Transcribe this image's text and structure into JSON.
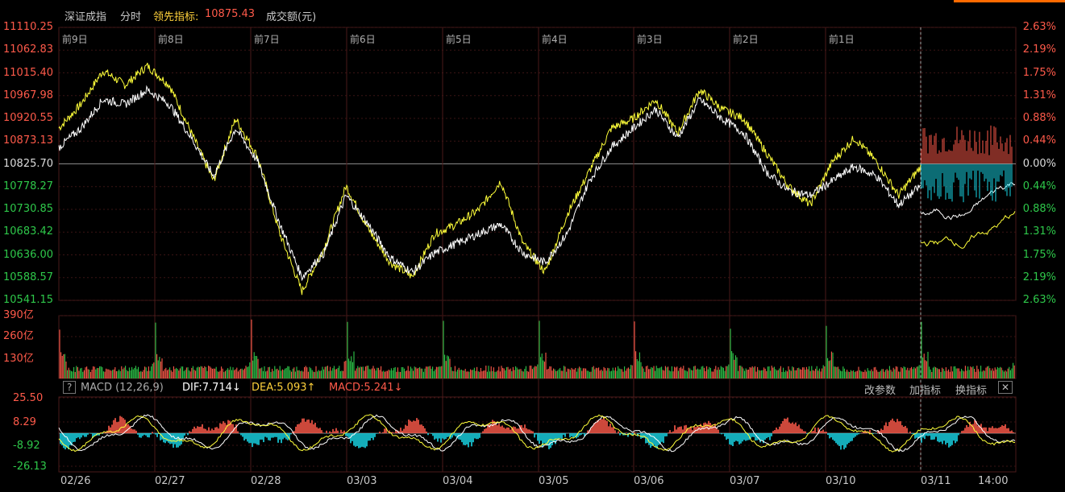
{
  "header": {
    "index_name": "深证成指",
    "mode": "分时",
    "lead_label": "领先指标:",
    "lead_value": "10875.43",
    "volume_label": "成交额(元)"
  },
  "day_labels": [
    "前9日",
    "前8日",
    "前7日",
    "前6日",
    "前5日",
    "前4日",
    "前3日",
    "前2日",
    "前1日"
  ],
  "price_axis": [
    "11110.25",
    "11062.83",
    "11015.40",
    "10967.98",
    "10920.55",
    "10873.13",
    "10825.70",
    "10778.27",
    "10730.85",
    "10683.42",
    "10636.00",
    "10588.57",
    "10541.15"
  ],
  "pct_axis": [
    "2.63%",
    "2.19%",
    "1.75%",
    "1.31%",
    "0.88%",
    "0.44%",
    "0.00%",
    "0.44%",
    "0.88%",
    "1.31%",
    "1.75%",
    "2.19%",
    "2.63%"
  ],
  "volume_axis": [
    "390亿",
    "260亿",
    "130亿"
  ],
  "macd": {
    "help": "?",
    "title": "MACD (12,26,9)",
    "dif": "DIF:7.714↓",
    "dea": "DEA:5.093↑",
    "macd": "MACD:5.241↓",
    "btn_change_params": "改参数",
    "btn_add_indicator": "加指标",
    "btn_switch_indicator": "换指标",
    "btn_close": "✕",
    "axis": [
      "25.50",
      "8.29",
      "-8.92",
      "-26.13"
    ]
  },
  "dates": [
    "02/26",
    "02/27",
    "02/28",
    "03/03",
    "03/04",
    "03/05",
    "03/06",
    "03/07",
    "03/10",
    "03/11",
    "14:00"
  ],
  "colors": {
    "up": "#ff5a4a",
    "down": "#2ec84a",
    "white_line": "#ffffff",
    "yellow_line": "#ffff3a",
    "cyan_bar": "#19d8e8",
    "grid": "#3a0f0f"
  },
  "chart_data": [
    {
      "type": "line",
      "series": [
        {
          "values": [
            10900,
            10950,
            11020,
            10990,
            11030,
            10990,
            10890,
            10790,
            10920,
            10840,
            10680,
            10560,
            10650,
            10780,
            10690,
            10620,
            10590,
            10680,
            10700,
            10730,
            10790,
            10660,
            10600,
            10720,
            10810,
            10900,
            10920,
            10960,
            10890,
            10980,
            10940,
            10920,
            10850,
            10780,
            10740,
            10830,
            10880,
            10830,
            10760,
            10820
          ]
        },
        {
          "values": [
            10860,
            10900,
            10960,
            10950,
            10980,
            10950,
            10880,
            10800,
            10900,
            10830,
            10700,
            10590,
            10640,
            10760,
            10700,
            10630,
            10600,
            10640,
            10660,
            10680,
            10700,
            10640,
            10620,
            10680,
            10790,
            10860,
            10900,
            10940,
            10880,
            10960,
            10920,
            10890,
            10810,
            10770,
            10760,
            10790,
            10820,
            10800,
            10740,
            10780
          ]
        }
      ]
    },
    {
      "type": "bar",
      "ylim": [
        0,
        390
      ]
    },
    {
      "type": "bar",
      "ylim": [
        -26.13,
        25.5
      ]
    }
  ]
}
